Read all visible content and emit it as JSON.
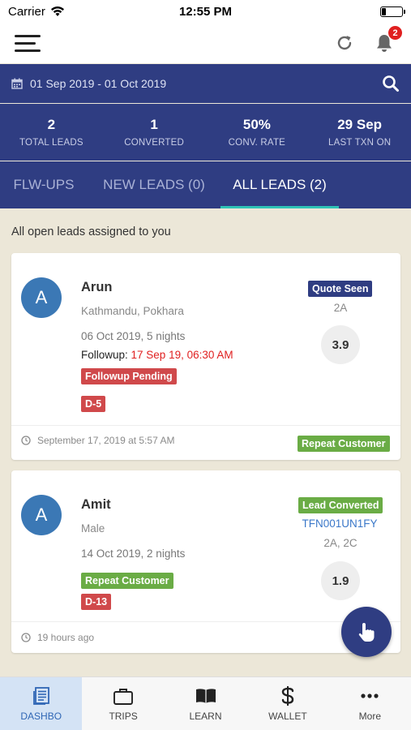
{
  "status_bar": {
    "carrier": "Carrier",
    "time": "12:55 PM",
    "battery_level": 0.2
  },
  "header": {
    "notification_count": "2"
  },
  "date_bar": {
    "range": "01 Sep 2019 - 01 Oct 2019"
  },
  "stats": [
    {
      "value": "2",
      "label": "TOTAL LEADS"
    },
    {
      "value": "1",
      "label": "CONVERTED"
    },
    {
      "value": "50%",
      "label": "CONV. RATE"
    },
    {
      "value": "29 Sep",
      "label": "LAST TXN ON"
    }
  ],
  "tabs": [
    {
      "label": "FLW-UPS"
    },
    {
      "label": "NEW LEADS (0)"
    },
    {
      "label": "ALL LEADS (2)"
    }
  ],
  "caption": "All open leads assigned to you",
  "leads": [
    {
      "initial": "A",
      "name": "Arun",
      "subtitle": "Kathmandu, Pokhara",
      "dates": "06 Oct 2019, 5 nights",
      "followup_label": "Followup: ",
      "followup_value": "17 Sep 19, 06:30 AM",
      "tag1": "Followup Pending",
      "tag2": "D-5",
      "status": "Quote Seen",
      "pax": "2A",
      "score": "3.9",
      "timestamp": "September 17, 2019 at 5:57 AM",
      "footer_tag": "Repeat Customer"
    },
    {
      "initial": "A",
      "name": "Amit",
      "subtitle": "Male",
      "dates": "14 Oct 2019, 2 nights",
      "tag1": "Repeat Customer",
      "tag2": "D-13",
      "status": "Lead Converted",
      "txn_id": "TFN001UN1FY",
      "pax": "2A, 2C",
      "score": "1.9",
      "timestamp": "19 hours ago"
    }
  ],
  "bottom_nav": [
    {
      "label": "DASHBO",
      "icon": "dashboard-icon"
    },
    {
      "label": "TRIPS",
      "icon": "briefcase-icon"
    },
    {
      "label": "LEARN",
      "icon": "book-icon"
    },
    {
      "label": "WALLET",
      "icon": "dollar-icon"
    },
    {
      "label": "More",
      "icon": "more-icon"
    }
  ],
  "colors": {
    "primary": "#2f3d82",
    "accent_tab": "#2ec4b6",
    "tag_red": "#d0494b",
    "tag_green": "#6aac45",
    "avatar": "#3b78b5",
    "background": "#ece7d8"
  }
}
